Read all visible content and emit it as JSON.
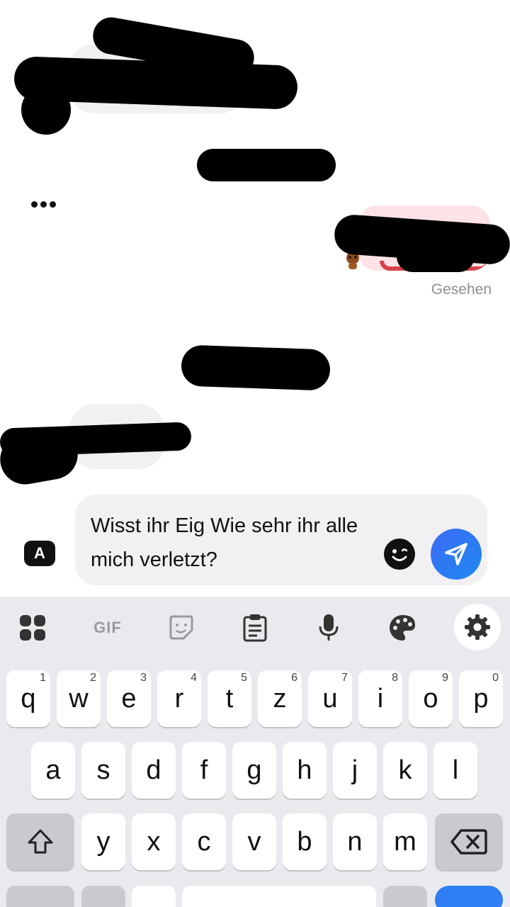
{
  "conversation": {
    "seen_label": "Gesehen"
  },
  "composer": {
    "input_value": "Wisst ihr Eig Wie sehr ihr alle mich verletzt?",
    "apps_button_label": "A"
  },
  "keyboard": {
    "toolbar": {
      "gif_label": "GIF",
      "icons": [
        "apps-grid-icon",
        "gif-icon",
        "sticker-icon",
        "clipboard-icon",
        "microphone-icon",
        "palette-icon",
        "gear-icon"
      ]
    },
    "row1": [
      {
        "key": "q",
        "hint": "1"
      },
      {
        "key": "w",
        "hint": "2"
      },
      {
        "key": "e",
        "hint": "3"
      },
      {
        "key": "r",
        "hint": "4"
      },
      {
        "key": "t",
        "hint": "5"
      },
      {
        "key": "z",
        "hint": "6"
      },
      {
        "key": "u",
        "hint": "7"
      },
      {
        "key": "i",
        "hint": "8"
      },
      {
        "key": "o",
        "hint": "9"
      },
      {
        "key": "p",
        "hint": "0"
      }
    ],
    "row2": [
      "a",
      "s",
      "d",
      "f",
      "g",
      "h",
      "j",
      "k",
      "l"
    ],
    "row3": [
      "y",
      "x",
      "c",
      "v",
      "b",
      "n",
      "m"
    ]
  },
  "colors": {
    "send_button": "#2f7df3",
    "outgoing_bubble": "#fde3e5",
    "outgoing_rim": "#d9414c",
    "keyboard_bg": "#e9eaee"
  }
}
